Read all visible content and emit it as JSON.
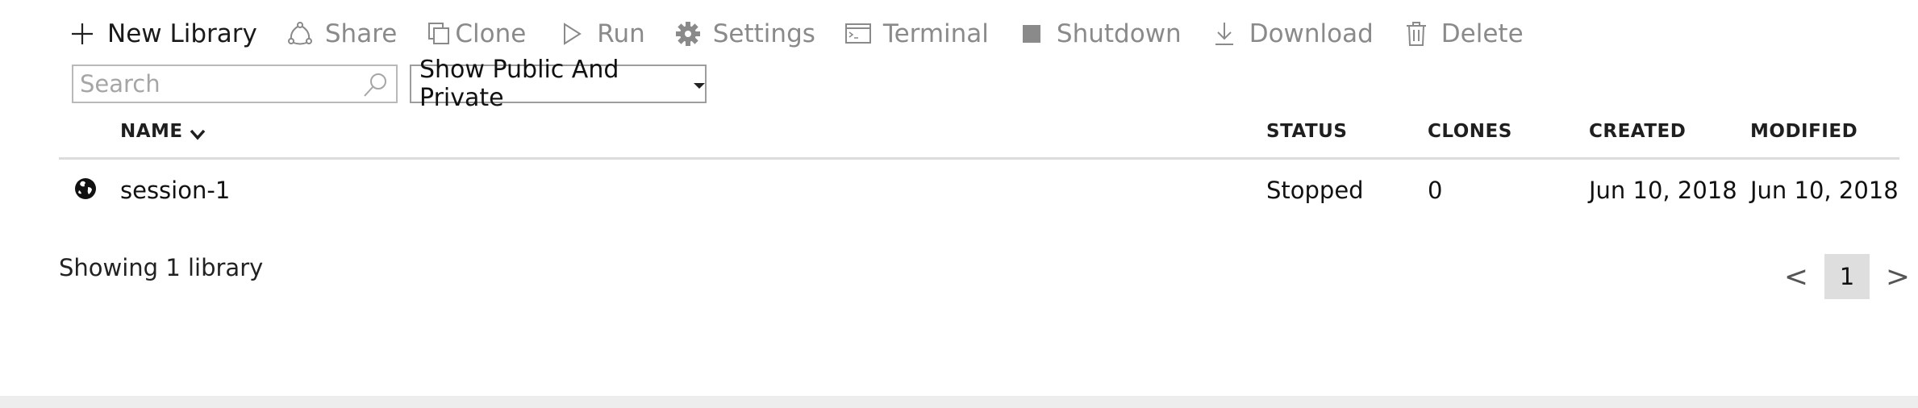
{
  "toolbar": {
    "new_library": "New Library",
    "share": "Share",
    "clone": "Clone",
    "run": "Run",
    "settings": "Settings",
    "terminal": "Terminal",
    "shutdown": "Shutdown",
    "download": "Download",
    "delete": "Delete",
    "icons": [
      "plus-icon",
      "share-icon",
      "clone-icon",
      "play-icon",
      "gear-icon",
      "terminal-icon",
      "stop-icon",
      "download-icon",
      "trash-icon"
    ]
  },
  "filters": {
    "search_placeholder": "Search",
    "search_value": "",
    "visibility_selected": "Show Public And Private"
  },
  "table": {
    "columns": {
      "name": "NAME",
      "status": "STATUS",
      "clones": "CLONES",
      "created": "CREATED",
      "modified": "MODIFIED"
    },
    "sort": {
      "column": "name",
      "direction": "descending"
    },
    "rows": [
      {
        "visibility_icon": "globe-icon",
        "name": "session-1",
        "status": "Stopped",
        "clones": "0",
        "created": "Jun 10, 2018",
        "modified": "Jun 10, 2018"
      }
    ]
  },
  "summary": "Showing 1 library",
  "pagination": {
    "prev": "<",
    "current": "1",
    "next": ">"
  },
  "colors": {
    "active_text": "#1a1a1a",
    "disabled_text": "#8a8a8a",
    "header_rule": "#dcdcdc",
    "page_highlight": "#dedede",
    "footer_bar": "#ededed"
  }
}
